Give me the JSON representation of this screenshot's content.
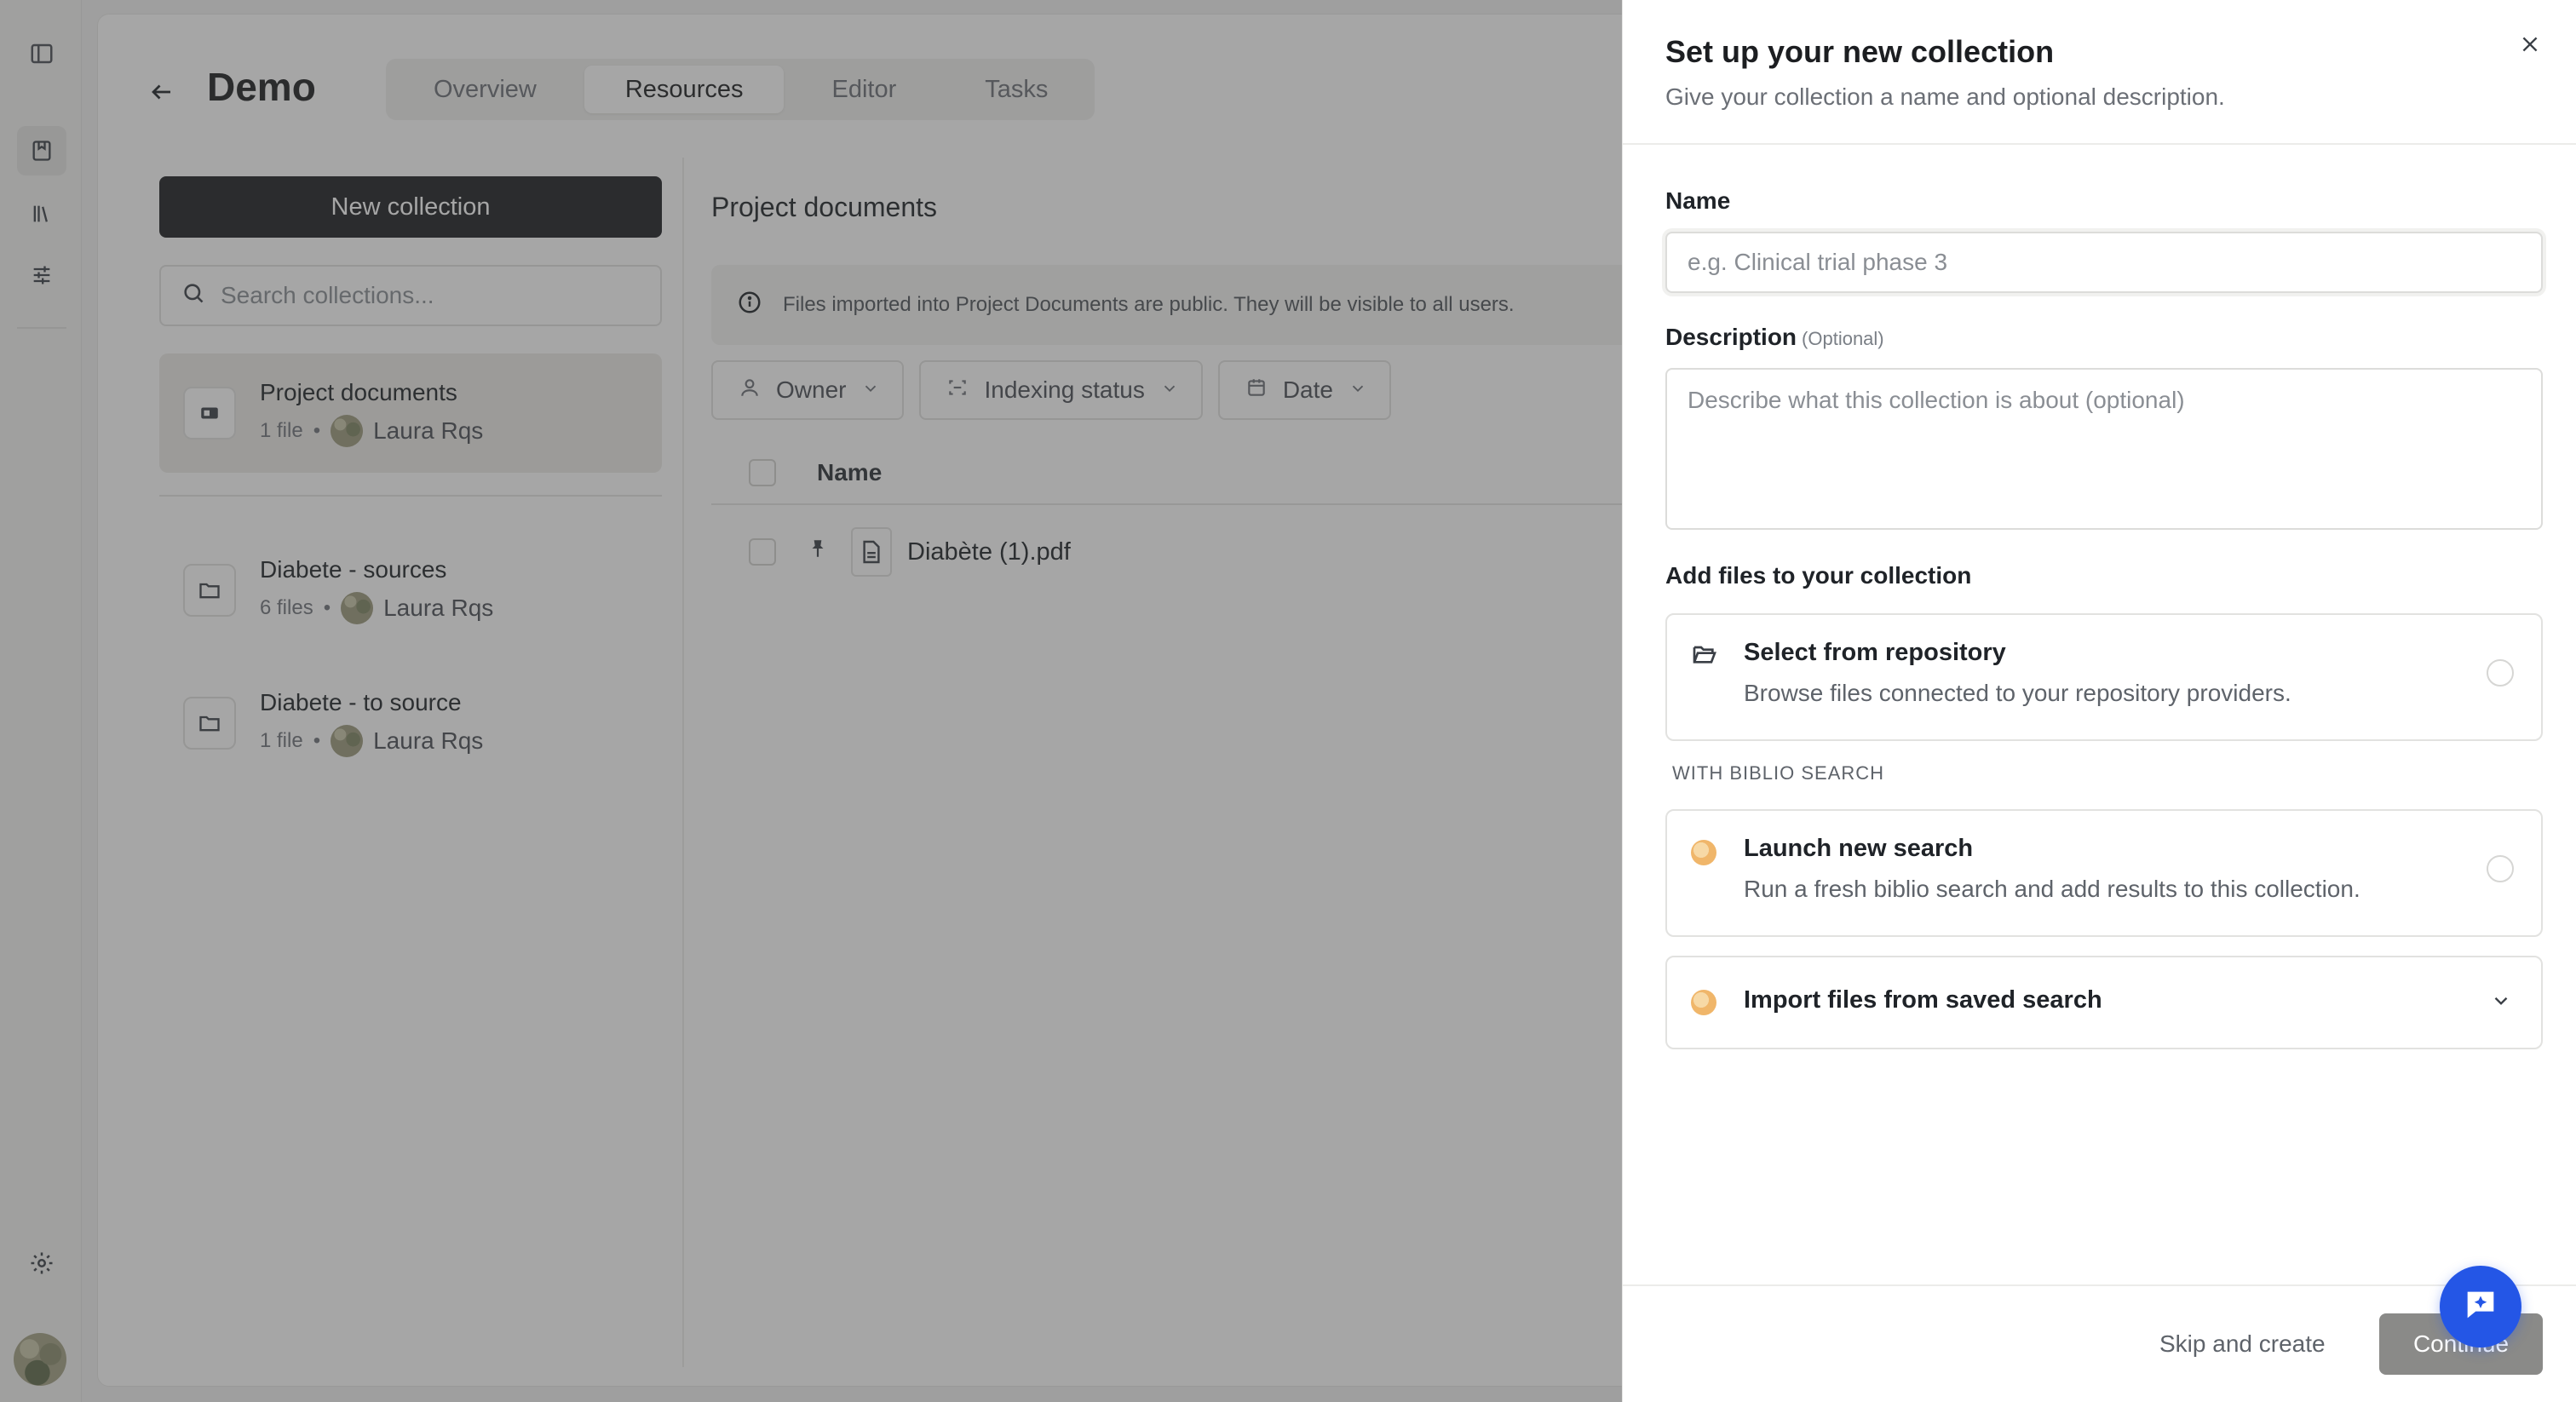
{
  "project": {
    "title": "Demo",
    "tabs": [
      {
        "label": "Overview"
      },
      {
        "label": "Resources"
      },
      {
        "label": "Editor"
      },
      {
        "label": "Tasks"
      }
    ]
  },
  "collections": {
    "new_button": "New collection",
    "search_placeholder": "Search collections...",
    "items": [
      {
        "name": "Project documents",
        "count": "1 file",
        "owner": "Laura Rqs"
      },
      {
        "name": "Diabete - sources",
        "count": "6 files",
        "owner": "Laura Rqs"
      },
      {
        "name": "Diabete - to source",
        "count": "1 file",
        "owner": "Laura Rqs"
      }
    ],
    "bullet": "•"
  },
  "documents": {
    "title": "Project documents",
    "notice": "Files imported into Project Documents are public. They will be visible to all users.",
    "filters": [
      {
        "label": "Owner",
        "icon": "user-icon"
      },
      {
        "label": "Indexing status",
        "icon": "scan-icon"
      },
      {
        "label": "Date",
        "icon": "calendar-icon"
      }
    ],
    "column_name": "Name",
    "rows": [
      {
        "name": "Diabète (1).pdf"
      }
    ]
  },
  "sheet": {
    "title": "Set up your new collection",
    "subtitle": "Give your collection a name and optional description.",
    "name_label": "Name",
    "name_placeholder": "e.g. Clinical trial phase 3",
    "description_label": "Description",
    "description_optional": "(Optional)",
    "description_placeholder": "Describe what this collection is about (optional)",
    "add_files_label": "Add files to your collection",
    "repo_option": {
      "title": "Select from repository",
      "description": "Browse files connected to your repository providers."
    },
    "biblio_caption": "WITH BIBLIO SEARCH",
    "launch_option": {
      "title": "Launch new search",
      "description": "Run a fresh biblio search and add results to this collection."
    },
    "import_option": {
      "title": "Import files from saved search"
    },
    "skip_label": "Skip and create",
    "continue_label": "Continue"
  },
  "colors": {
    "primary_dark": "#1d1f22",
    "fab_blue": "#2456e6",
    "continue_disabled": "#8a8a88"
  }
}
